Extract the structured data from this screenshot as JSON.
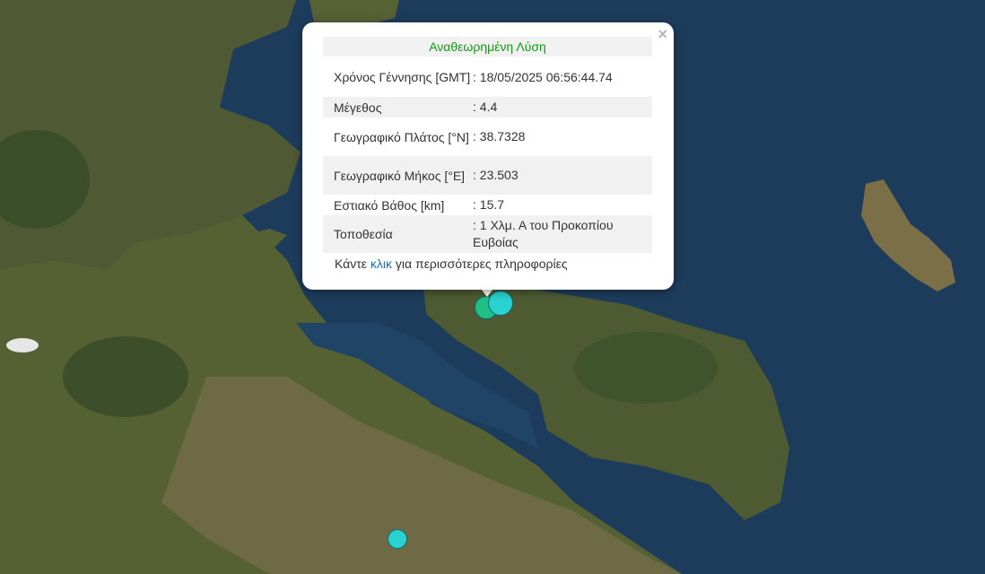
{
  "popup": {
    "title": "Αναθεωρημένη Λύση",
    "close": "×",
    "rows": [
      {
        "key": "Χρόνος Γέννησης [GMT]",
        "value": ": 18/05/2025 06:56:44.74"
      },
      {
        "key": "Μέγεθος",
        "value": ": 4.4"
      },
      {
        "key": "Γεωγραφικό Πλάτος [°N]",
        "value": ": 38.7328"
      },
      {
        "key": "Γεωγραφικό Μήκος [°E]",
        "value": ": 23.503"
      },
      {
        "key": "Εστιακό Βάθος [km]",
        "value": ": 15.7"
      },
      {
        "key": "Τοποθεσία",
        "value": ": 1 Χλμ. Α του Προκοπίου Ευβοίας"
      }
    ],
    "more_prefix": "Κάντε ",
    "more_link": "κλικ",
    "more_suffix": " για περισσότερες πληροφορίες"
  },
  "colors": {
    "title_green": "#139a13",
    "link_blue": "#1a6fb5",
    "marker_cyan": "#2ad1d1",
    "marker_green": "#1fbf86"
  },
  "markers": [
    "earthquake-marker",
    "earthquake-marker",
    "earthquake-marker",
    "earthquake-marker"
  ]
}
